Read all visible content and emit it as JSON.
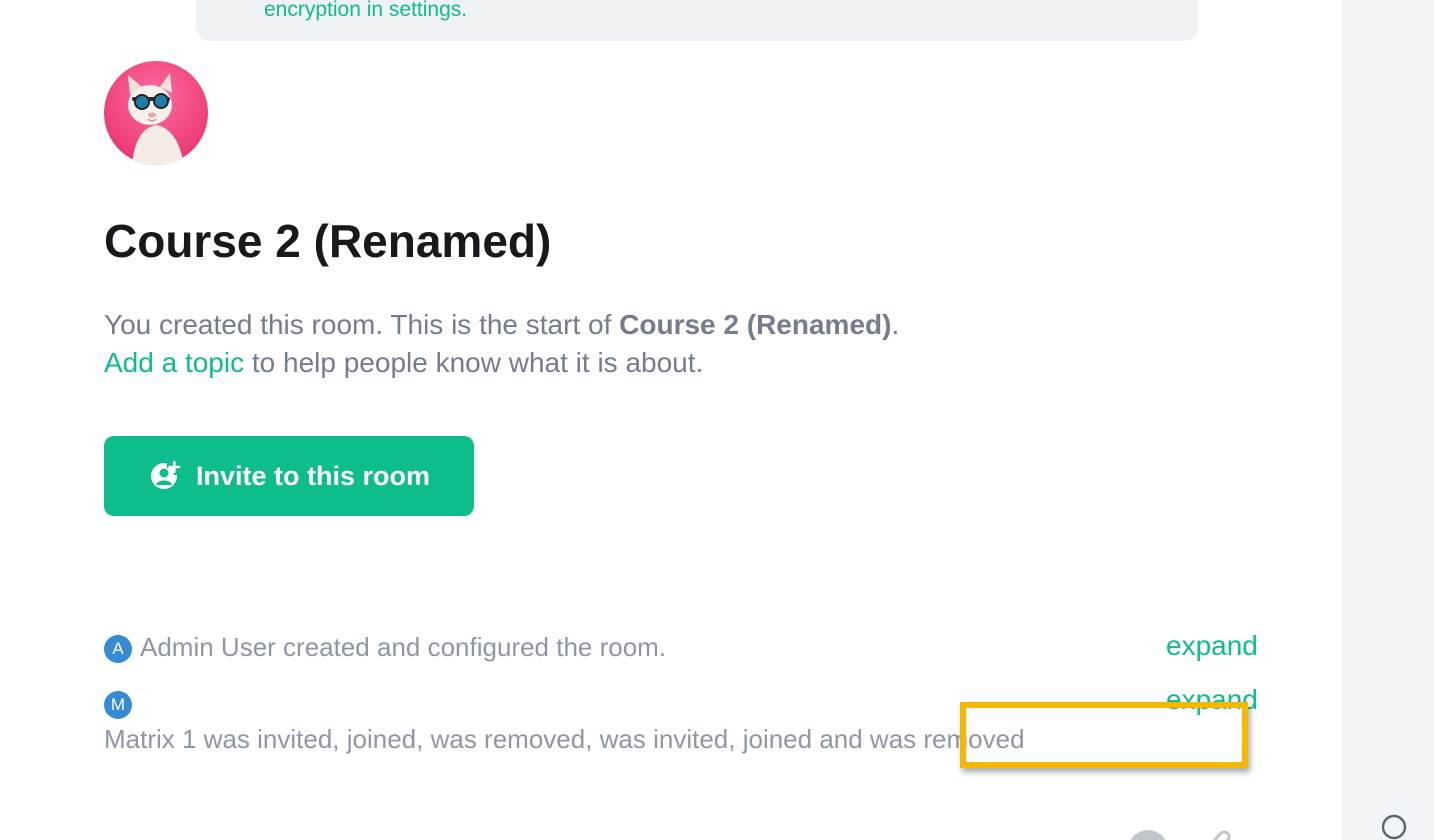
{
  "notice": {
    "text": "encryption in settings."
  },
  "room": {
    "name": "Course 2 (Renamed)",
    "avatar_icon": "cat-with-sunglasses-avatar"
  },
  "intro": {
    "line1_prefix": "You created this room. This is the start of ",
    "line1_room": "Course 2 (Renamed)",
    "line1_suffix": ".",
    "topic_link": "Add a topic",
    "line2_suffix": " to help people know what it is about."
  },
  "invite": {
    "label": "Invite to this room",
    "icon": "add-user-icon"
  },
  "events": [
    {
      "avatar_letter": "A",
      "text": "Admin User created and configured the room.",
      "action": "expand"
    },
    {
      "avatar_letter": "M",
      "text": "Matrix 1 was invited, joined, was removed, was invited, joined and was removed",
      "action": "expand"
    }
  ],
  "colors": {
    "accent": "#0dbd8b",
    "avatar_blue": "#368bd6",
    "highlight": "#f5b800",
    "secondary_text": "#737d8c"
  }
}
